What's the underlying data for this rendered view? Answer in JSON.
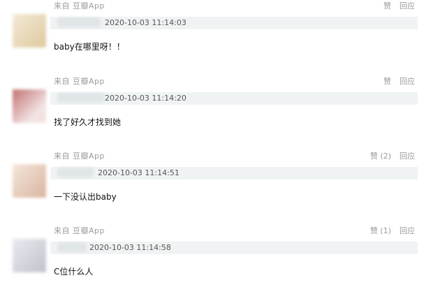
{
  "comments": [
    {
      "source": "来自 豆瓣App",
      "timestamp": "2020-10-03 11:14:03",
      "text": "baby在哪里呀！！",
      "like_label": "赞",
      "reply_label": "回应",
      "avatar_color": "#e3d2b0"
    },
    {
      "source": "来自 豆瓣App",
      "timestamp": "2020-10-03 11:14:20",
      "text": "找了好久才找到她",
      "like_label": "赞",
      "reply_label": "回应",
      "avatar_color": "#c98f8f"
    },
    {
      "source": "来自 豆瓣App",
      "timestamp": "2020-10-03 11:14:51",
      "text": "一下没认出baby",
      "like_label": "赞 (2)",
      "reply_label": "回应",
      "avatar_color": "#e8cfc0"
    },
    {
      "source": "来自 豆瓣App",
      "timestamp": "2020-10-03 11:14:58",
      "text": "C位什么人",
      "like_label": "赞 (1)",
      "reply_label": "回应",
      "avatar_color": "#cfcfd6"
    }
  ]
}
